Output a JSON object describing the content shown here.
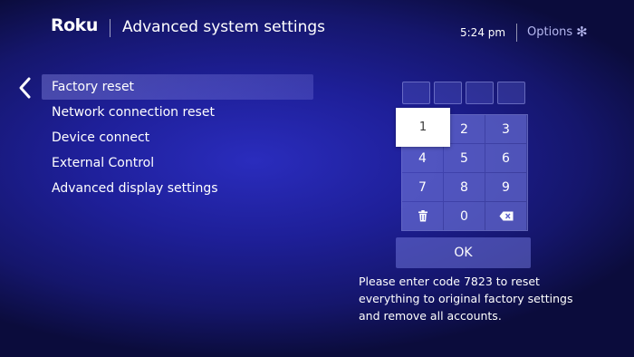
{
  "header": {
    "logo": "Roku",
    "title": "Advanced system settings",
    "time": "5:24 pm",
    "options_label": "Options",
    "options_icon": "asterisk-icon"
  },
  "menu": {
    "back_icon": "chevron-left-icon",
    "items": [
      {
        "label": "Factory reset",
        "selected": true
      },
      {
        "label": "Network connection reset",
        "selected": false
      },
      {
        "label": "Device connect",
        "selected": false
      },
      {
        "label": "External Control",
        "selected": false
      },
      {
        "label": "Advanced display settings",
        "selected": false
      }
    ]
  },
  "keypad": {
    "code_length": 4,
    "keys": [
      "1",
      "2",
      "3",
      "4",
      "5",
      "6",
      "7",
      "8",
      "9",
      "trash-icon",
      "0",
      "backspace-icon"
    ],
    "focused_key": "1",
    "ok_label": "OK"
  },
  "instructions": "Please enter code 7823 to reset everything to original factory settings and remove all accounts.",
  "colors": {
    "background": "#1e1f98",
    "options_text": "#b7b9f2",
    "focus": "#ffffff"
  }
}
